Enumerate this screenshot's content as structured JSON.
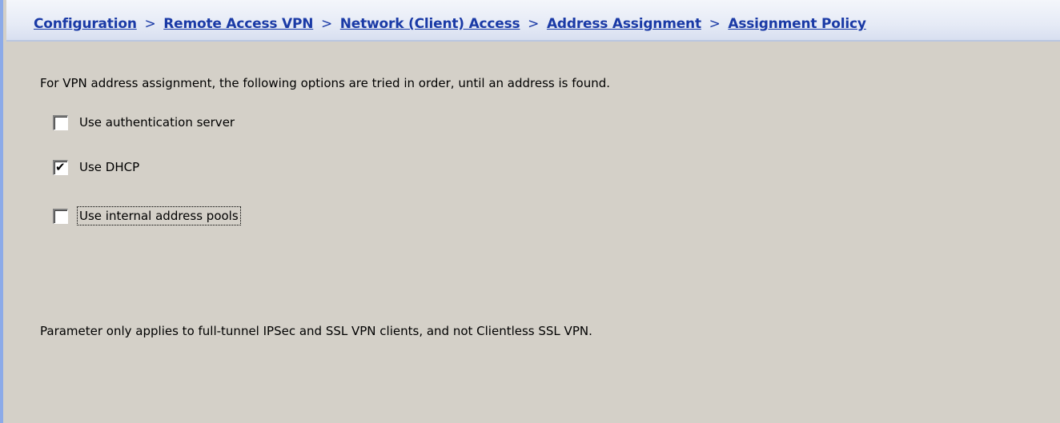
{
  "breadcrumb": {
    "items": [
      "Configuration",
      "Remote Access VPN",
      "Network (Client) Access",
      "Address Assignment",
      "Assignment Policy"
    ],
    "separator": ">"
  },
  "intro_text": "For VPN address assignment, the following options are tried in order, until an address is found.",
  "options": [
    {
      "label": "Use authentication server",
      "checked": false
    },
    {
      "label": "Use DHCP",
      "checked": true
    },
    {
      "label": "Use internal address pools",
      "checked": false,
      "focused": true
    }
  ],
  "note_text": "Parameter only applies to full-tunnel IPSec and SSL VPN clients, and not Clientless SSL VPN.",
  "colors": {
    "link": "#1a3aa6",
    "background": "#d4d0c8",
    "accent_border": "#8caae8"
  },
  "icons": {
    "checkmark": "checkmark-icon"
  }
}
